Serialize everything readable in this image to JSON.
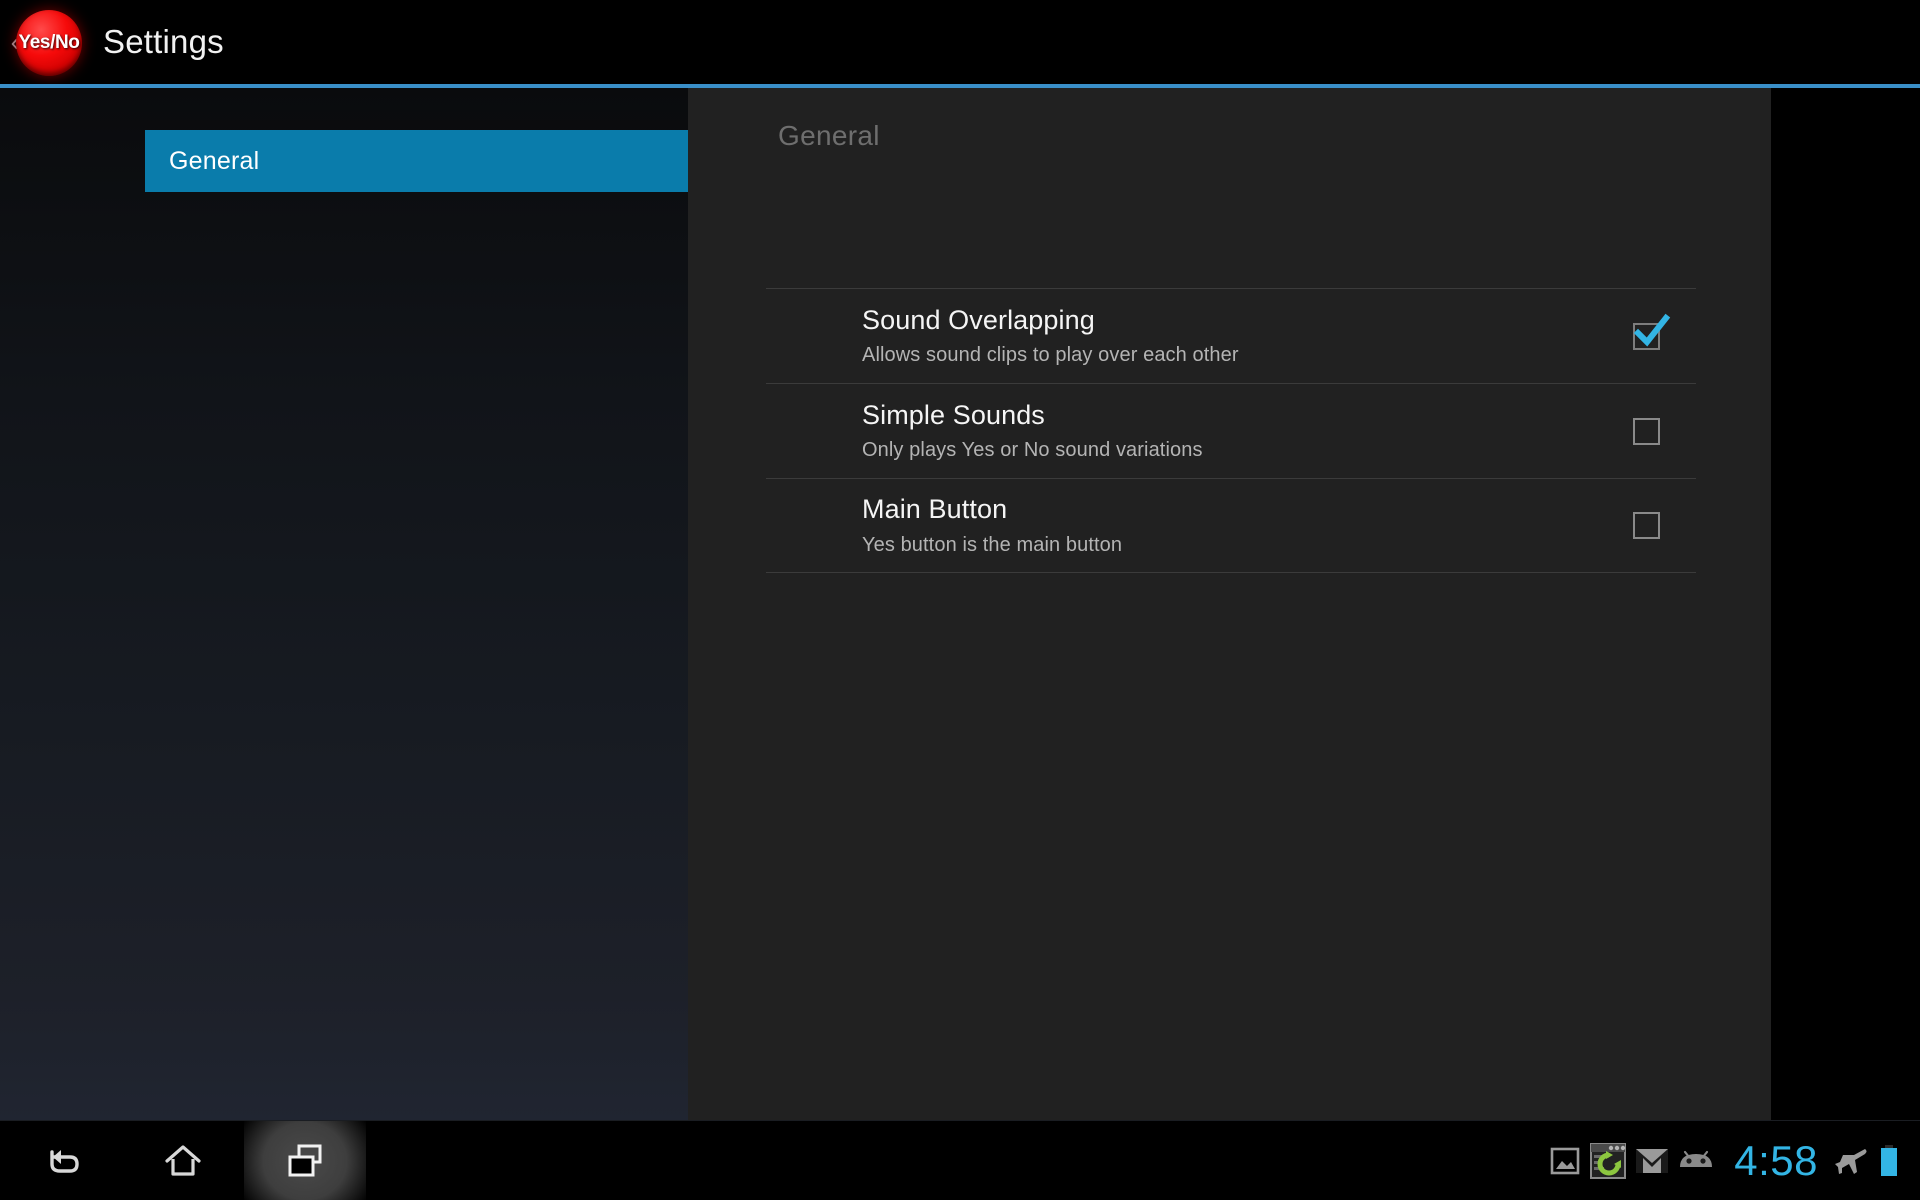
{
  "action_bar": {
    "up_caret": "‹",
    "app_icon_label": "Yes/No",
    "app_icon_name": "yes-no-red-button-icon",
    "title": "Settings",
    "divider_color": "#3a8fc8"
  },
  "sidebar": {
    "items": [
      {
        "label": "General",
        "selected": true
      }
    ],
    "selected_color": "#0a7cab"
  },
  "content": {
    "header": "General",
    "preferences": [
      {
        "title": "Sound Overlapping",
        "summary": "Allows sound clips to play over each other",
        "checked": true
      },
      {
        "title": "Simple Sounds",
        "summary": "Only plays Yes or No sound variations",
        "checked": false
      },
      {
        "title": "Main Button",
        "summary": "Yes button is the main button",
        "checked": false
      }
    ],
    "panel_color": "#212121",
    "check_color": "#33b5e5"
  },
  "nav_bar": {
    "buttons": [
      {
        "name": "back",
        "label": "Back"
      },
      {
        "name": "home",
        "label": "Home"
      },
      {
        "name": "recent-apps",
        "label": "Recent apps",
        "pressed": true
      }
    ]
  },
  "status_tray": {
    "icons": [
      {
        "name": "screenshot-icon",
        "label": "Screenshot"
      },
      {
        "name": "app-update-sync-icon",
        "label": "App update"
      },
      {
        "name": "gmail-icon",
        "label": "Gmail"
      },
      {
        "name": "android-robot-icon",
        "label": "Android system"
      }
    ],
    "clock": "4:58",
    "clock_color": "#33b5e5",
    "airplane_mode_icon": "airplane-mode-icon",
    "battery_icon": "battery-full-icon",
    "battery_color": "#33b5e5"
  }
}
